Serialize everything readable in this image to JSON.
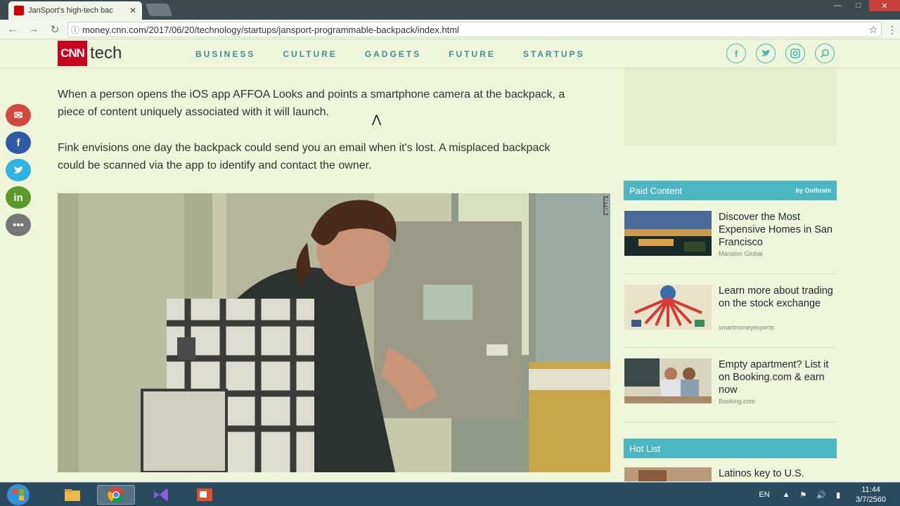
{
  "browser": {
    "tab_title": "JanSport's high-tech bac",
    "tab_close": "✕",
    "url": "money.cnn.com/2017/06/20/technology/startups/jansport-programmable-backpack/index.html"
  },
  "site": {
    "logo_cnn": "CNN",
    "logo_tech": "tech",
    "nav": [
      "BUSINESS",
      "CULTURE",
      "GADGETS",
      "FUTURE",
      "STARTUPS"
    ],
    "social_icons": [
      "facebook-icon",
      "twitter-icon",
      "instagram-icon",
      "search-icon"
    ]
  },
  "share_bar": [
    "mail-icon",
    "facebook-icon",
    "twitter-icon",
    "linkedin-icon",
    "more-icon"
  ],
  "article": {
    "para1": "When a person opens the iOS app AFFOA Looks and points a smartphone camera at the backpack, a piece of content uniquely associated with it will launch.",
    "para2": "Fink envisions one day the backpack could send you an email when it's lost. A misplaced backpack could be scanned via the app to identify and contact the owner."
  },
  "sidebar": {
    "paid_title": "Paid Content",
    "paid_by": "by Outbrain",
    "items": [
      {
        "title": "Discover the Most Expensive Homes in San Francisco",
        "source": "Mansion Global"
      },
      {
        "title": "Learn more about trading on the stock exchange",
        "source": "smartmoneyexperts"
      },
      {
        "title": "Empty apartment? List it on Booking.com & earn now",
        "source": "Booking.com"
      }
    ],
    "hot_title": "Hot List",
    "hot_items": [
      {
        "title": "Latinos key to U.S."
      }
    ]
  },
  "taskbar": {
    "lang": "EN",
    "time": "11:44",
    "date": "3/7/2560"
  },
  "colors": {
    "accent": "#4cb7c0",
    "cnn_red": "#c8001e"
  }
}
